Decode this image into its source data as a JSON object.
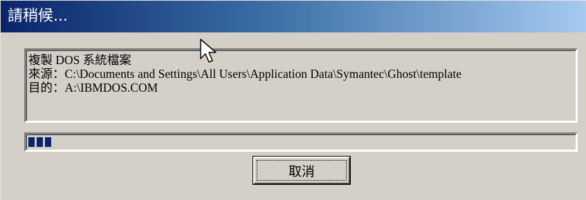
{
  "window": {
    "title": "請稍候..."
  },
  "message": {
    "line1": "複製 DOS 系統檔案",
    "line2": "來源：C:\\Documents and Settings\\All Users\\Application Data\\Symantec\\Ghost\\template",
    "line3": "目的：A:\\IBMDOS.COM"
  },
  "progress": {
    "blocks": 3,
    "fill_color": "#0a246a"
  },
  "buttons": {
    "cancel_label": "取消"
  },
  "colors": {
    "dialog_face": "#d4d0c8",
    "title_gradient_start": "#0a246a",
    "title_gradient_end": "#a6caf0"
  },
  "icons": {
    "cursor": "mouse-pointer-icon"
  }
}
